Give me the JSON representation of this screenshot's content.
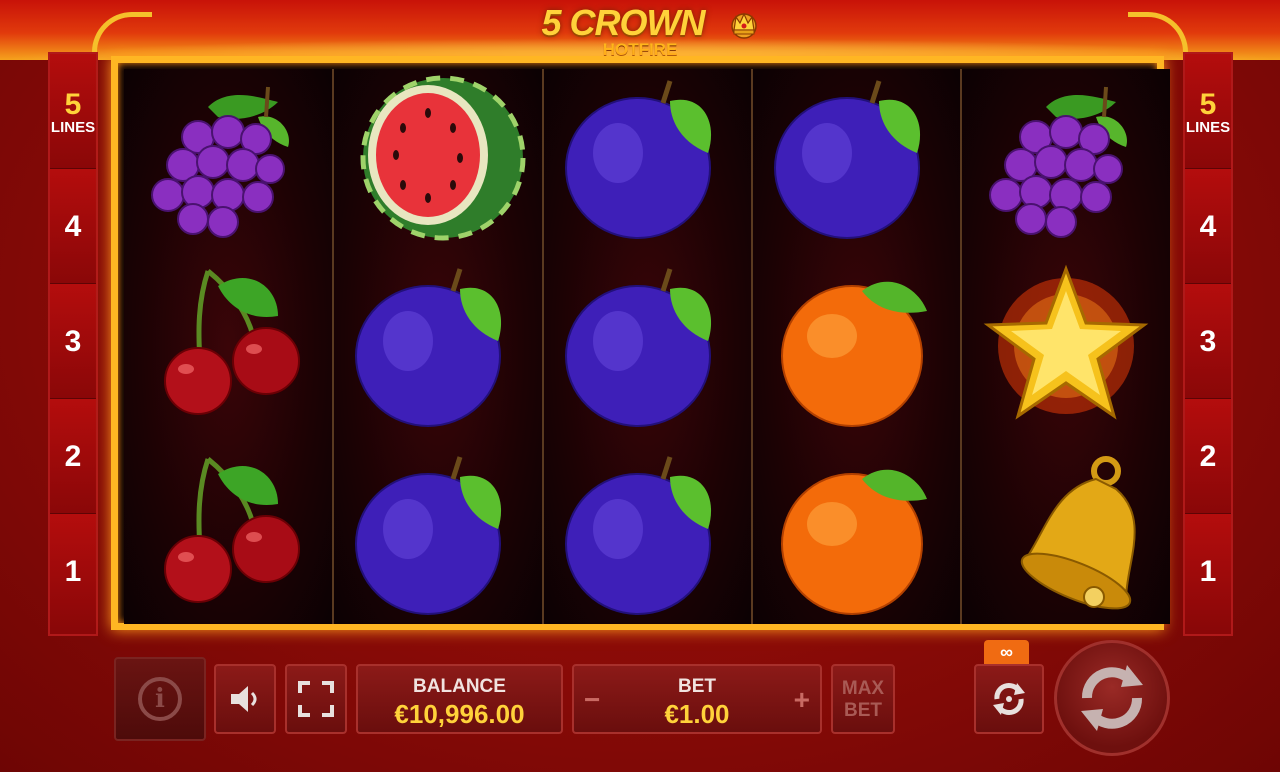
{
  "game": {
    "logo_main": "5 CROWN",
    "logo_sub": "HOTFIRE"
  },
  "lines_left": [
    "5",
    "LINES",
    "4",
    "3",
    "2",
    "1"
  ],
  "lines_right": [
    "5",
    "LINES",
    "4",
    "3",
    "2",
    "1"
  ],
  "reels": [
    [
      "grapes-icon",
      "cherries-icon",
      "cherries-icon"
    ],
    [
      "watermelon-icon",
      "plum-icon",
      "plum-icon"
    ],
    [
      "plum-icon",
      "plum-icon",
      "plum-icon"
    ],
    [
      "plum-icon",
      "orange-icon",
      "orange-icon"
    ],
    [
      "grapes-icon",
      "star-icon",
      "bell-icon"
    ]
  ],
  "controls": {
    "balance_label": "BALANCE",
    "balance_value": "€10,996.00",
    "bet_label": "BET",
    "bet_value": "€1.00",
    "bet_minus": "−",
    "bet_plus": "+",
    "max_bet_1": "MAX",
    "max_bet_2": "BET",
    "autoplay_badge": "∞",
    "info_icon": "i"
  },
  "colors": {
    "accent": "#ffd23a",
    "frame": "#ffb623",
    "background": "#8f0c08"
  }
}
